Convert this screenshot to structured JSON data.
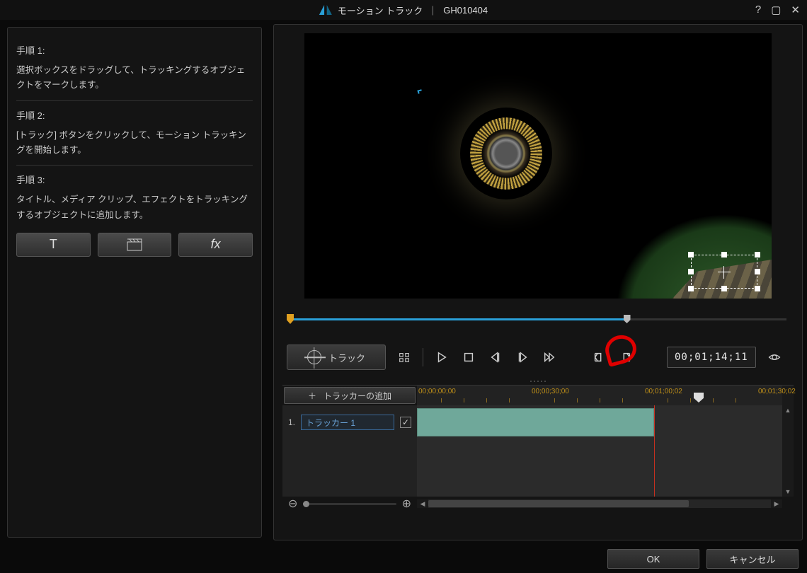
{
  "titlebar": {
    "title": "モーション トラック",
    "separator": "｜",
    "filename": "GH010404"
  },
  "sidebar": {
    "step1": {
      "title": "手順 1:",
      "body": "選択ボックスをドラッグして、トラッキングするオブジェクトをマークします。"
    },
    "step2": {
      "title": "手順 2:",
      "body": "[トラック] ボタンをクリックして、モーション トラッキングを開始します。"
    },
    "step3": {
      "title": "手順 3:",
      "body": "タイトル、メディア クリップ、エフェクトをトラッキングするオブジェクトに追加します。"
    },
    "buttons": {
      "title": "T",
      "media": "",
      "fx": "fx"
    }
  },
  "transport": {
    "track_label": "トラック",
    "timecode": "00;01;14;11"
  },
  "timeline": {
    "add_tracker": "トラッカーの追加",
    "ticks": [
      "00;00;00;00",
      "00;00;30;00",
      "00;01;00;02",
      "00;01;30;02"
    ],
    "tracker_index": "1.",
    "tracker_name": "トラッカー 1",
    "tracker_checked": "✓"
  },
  "footer": {
    "ok": "OK",
    "cancel": "キャンセル"
  }
}
